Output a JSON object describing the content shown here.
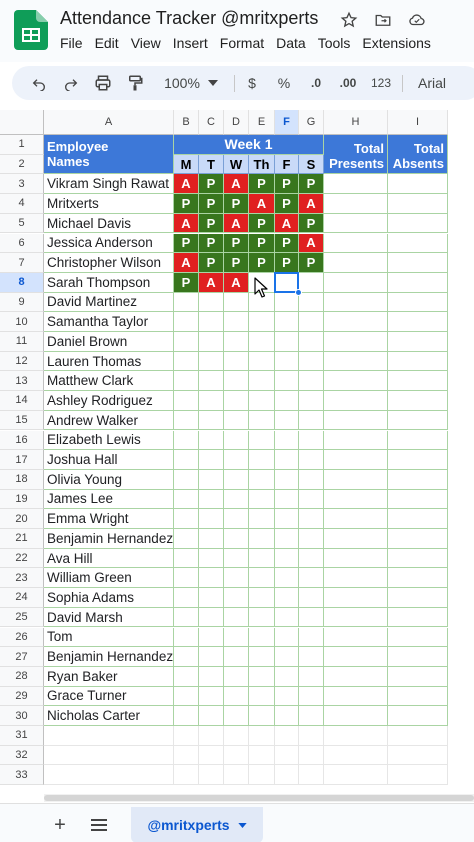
{
  "app": {
    "title": "Attendance Tracker @mritxperts",
    "menu": [
      "File",
      "Edit",
      "View",
      "Insert",
      "Format",
      "Data",
      "Tools",
      "Extensions"
    ]
  },
  "toolbar": {
    "zoom": "100%",
    "currency": "$",
    "percent": "%",
    "decrease_decimals": ".0",
    "increase_decimals": ".00",
    "number_format": "123",
    "font": "Arial"
  },
  "columns": [
    "A",
    "B",
    "C",
    "D",
    "E",
    "F",
    "G",
    "H",
    "I"
  ],
  "selected_column": "F",
  "selected_row": 8,
  "rows": [
    "1",
    "2",
    "3",
    "4",
    "5",
    "6",
    "7",
    "8",
    "9",
    "10",
    "11",
    "12",
    "13",
    "14",
    "15",
    "16",
    "17",
    "18",
    "19",
    "20",
    "21",
    "22",
    "23",
    "24",
    "25",
    "26",
    "27",
    "28",
    "29",
    "30",
    "31",
    "32",
    "33"
  ],
  "sheet": {
    "employee_header": "Employee\nNames",
    "employee_header_line1": "Employee",
    "employee_header_line2": "Names",
    "week_label": "Week 1",
    "days": [
      "M",
      "T",
      "W",
      "Th",
      "F",
      "S"
    ],
    "total_presents_line1": "Total",
    "total_presents_line2": "Presents",
    "total_absents_line1": "Total",
    "total_absents_line2": "Absents",
    "employees": [
      "Vikram Singh Rawat",
      "Mritxerts",
      "Michael Davis",
      "Jessica Anderson",
      "Christopher Wilson",
      "Sarah Thompson",
      "David Martinez",
      "Samantha Taylor",
      "Daniel Brown",
      "Lauren Thomas",
      "Matthew Clark",
      "Ashley Rodriguez",
      "Andrew Walker",
      "Elizabeth Lewis",
      "Joshua Hall",
      "Olivia Young",
      "James Lee",
      "Emma Wright",
      "Benjamin Hernandez",
      "Ava Hill",
      "William Green",
      "Sophia Adams",
      "David Marsh",
      "Tom",
      "Benjamin Hernandez",
      "Ryan Baker",
      "Grace Turner",
      "Nicholas Carter"
    ],
    "attendance": [
      [
        "A",
        "P",
        "A",
        "P",
        "P",
        "P"
      ],
      [
        "P",
        "P",
        "P",
        "A",
        "P",
        "A"
      ],
      [
        "A",
        "P",
        "A",
        "P",
        "A",
        "P"
      ],
      [
        "P",
        "P",
        "P",
        "P",
        "P",
        "A"
      ],
      [
        "A",
        "P",
        "P",
        "P",
        "P",
        "P"
      ],
      [
        "P",
        "A",
        "A",
        "",
        "",
        ""
      ]
    ]
  },
  "colors": {
    "present": "#38761d",
    "absent": "#e02020",
    "header_blue": "#3d78d8",
    "header_light": "#c9daf8",
    "selection": "#1a73e8"
  },
  "bottom": {
    "sheet_tab": "@mritxperts"
  }
}
